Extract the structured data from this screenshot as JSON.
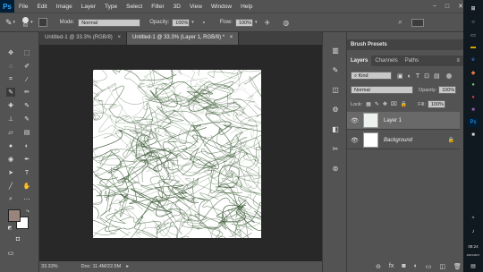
{
  "app": {
    "logo": "Ps"
  },
  "menu": [
    "File",
    "Edit",
    "Image",
    "Layer",
    "Type",
    "Select",
    "Filter",
    "3D",
    "View",
    "Window",
    "Help"
  ],
  "window_controls": [
    "−",
    "□",
    "✕"
  ],
  "options": {
    "brush_size": "60",
    "mode_label": "Mode:",
    "mode_value": "Normal",
    "opacity_label": "Opacity:",
    "opacity_value": "100%",
    "flow_label": "Flow:",
    "flow_value": "100%"
  },
  "tabs": [
    {
      "label": "Untitled-1 @ 33.3% (RGB/8)",
      "close": "×"
    },
    {
      "label": "Untitled-1 @ 33.3% (Layer 1, RGB/8) *",
      "close": "×"
    }
  ],
  "status": {
    "zoom": "33.33%",
    "doc": "Doc: 11.4M/22.5M",
    "arrow": "▸"
  },
  "panels": {
    "brush_presets": "Brush Presets",
    "tabs": [
      "Layers",
      "Channels",
      "Paths"
    ],
    "kind_label": "Kind",
    "blend_mode": "Normal",
    "opacity_label": "Opacity:",
    "opacity_value": "100%",
    "lock_label": "Lock:",
    "fill_label": "Fill:",
    "fill_value": "100%",
    "layers": [
      {
        "name": "Layer 1"
      },
      {
        "name": "Background"
      }
    ]
  },
  "colors": {
    "foreground": "#9a857c",
    "background": "#ffffff",
    "accent": "#31a8ff"
  },
  "taskbar": {
    "time": "08:24",
    "date": "19/01/2017"
  }
}
